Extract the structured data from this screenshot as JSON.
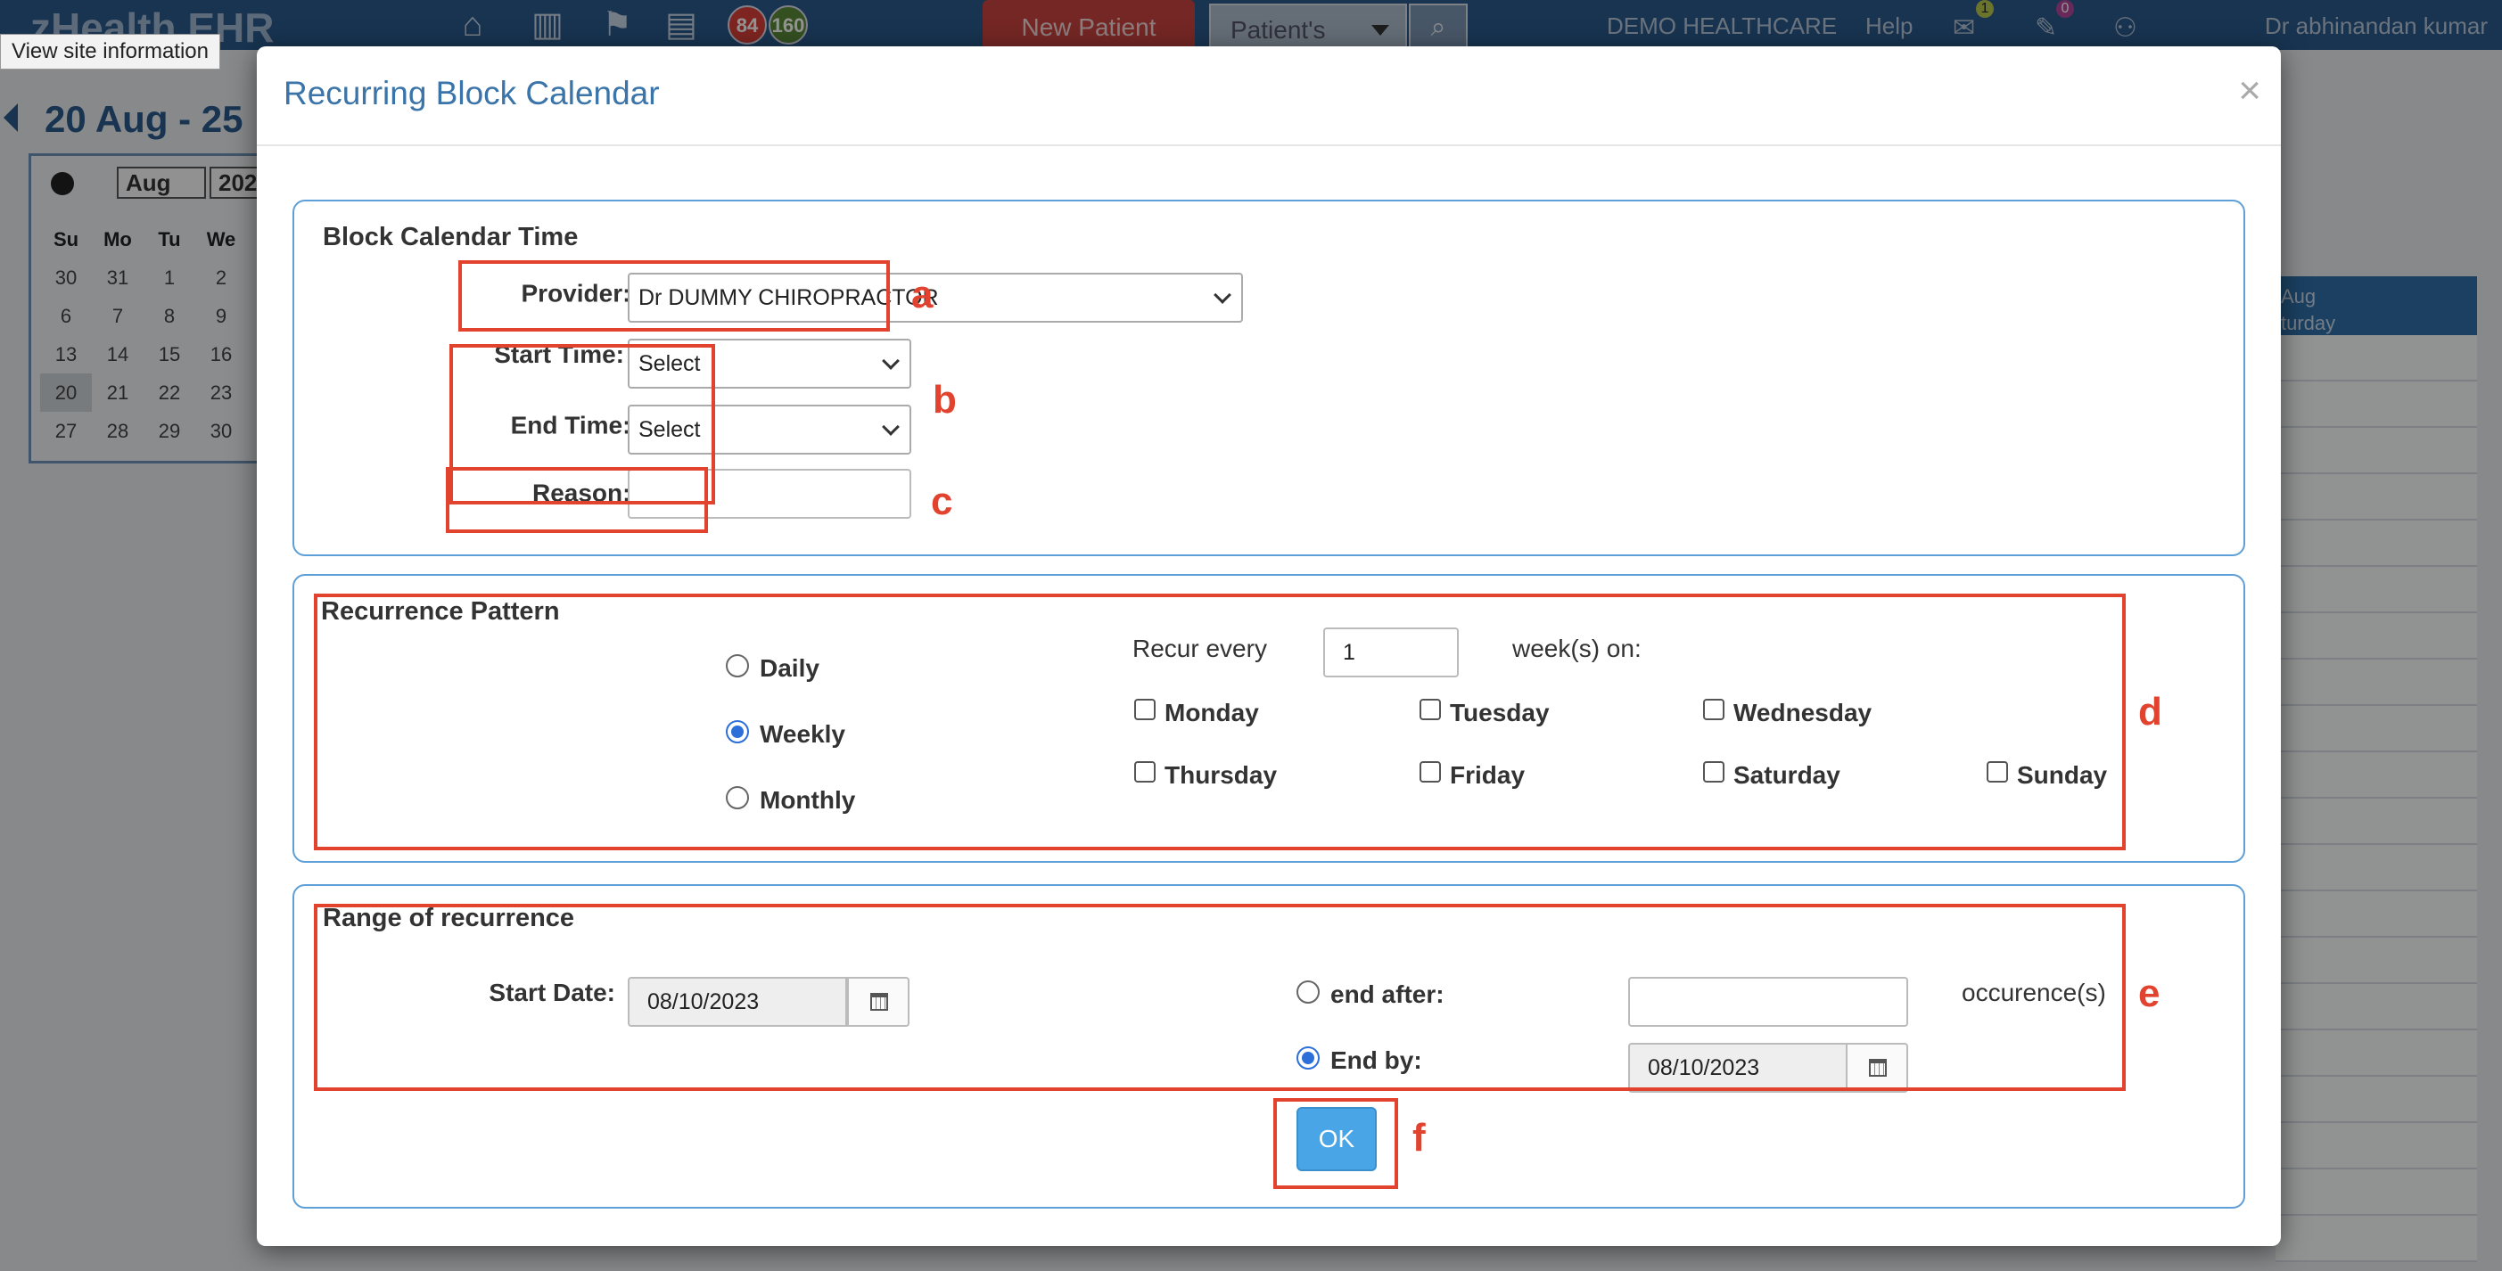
{
  "app": {
    "brand": "zHealth EHR",
    "site_info_tooltip": "View site information",
    "badges": [
      {
        "value": "84",
        "color": "#d9413a"
      },
      {
        "value": "160",
        "color": "#5b8a3a"
      }
    ],
    "new_patient_label": "New Patient",
    "patients_select_label": "Patient's",
    "org_name": "DEMO HEALTHCARE",
    "help_label": "Help",
    "mail_count": "1",
    "chat_count": "0",
    "user_name": "Dr abhinandan kumar",
    "date_range": "20 Aug - 25",
    "mini_calendar": {
      "month": "Aug",
      "year": "202",
      "weekdays": [
        "Su",
        "Mo",
        "Tu",
        "We"
      ],
      "rows": [
        [
          "30",
          "31",
          "1",
          "2"
        ],
        [
          "6",
          "7",
          "8",
          "9"
        ],
        [
          "13",
          "14",
          "15",
          "16"
        ],
        [
          "20",
          "21",
          "22",
          "23"
        ],
        [
          "27",
          "28",
          "29",
          "30"
        ]
      ]
    },
    "column_header_line1": "Aug",
    "column_header_line2": "turday"
  },
  "modal": {
    "title": "Recurring Block Calendar",
    "close_label": "×",
    "block_time": {
      "title": "Block Calendar Time",
      "provider_label": "Provider:",
      "provider_value": "Dr DUMMY CHIROPRACTOR",
      "start_time_label": "Start Time:",
      "start_time_value": "Select",
      "end_time_label": "End Time:",
      "end_time_value": "Select",
      "reason_label": "Reason:",
      "reason_value": "",
      "required_mark": "*"
    },
    "recurrence": {
      "title": "Recurrence Pattern",
      "options": [
        "Daily",
        "Weekly",
        "Monthly"
      ],
      "selected": "Weekly",
      "recur_every_label": "Recur every",
      "recur_every_value": "1",
      "weeks_on_label": "week(s) on:",
      "days": [
        "Monday",
        "Tuesday",
        "Wednesday",
        "Thursday",
        "Friday",
        "Saturday",
        "Sunday"
      ]
    },
    "range": {
      "title": "Range of recurrence",
      "start_date_label": "Start Date:",
      "start_date_value": "08/10/2023",
      "end_after_label": "end after:",
      "end_after_value": "",
      "occurrences_label": "occurence(s)",
      "end_by_label": "End by:",
      "end_by_value": "08/10/2023",
      "selected": "End by"
    },
    "ok_label": "OK"
  },
  "annotations": [
    "a",
    "b",
    "c",
    "d",
    "e",
    "f"
  ],
  "colors": {
    "annotation": "#e2432e",
    "section_border": "#5d9fd6",
    "title": "#3a74a8",
    "ok_button": "#4aa5e6",
    "radio_selected": "#2d6fd8"
  }
}
